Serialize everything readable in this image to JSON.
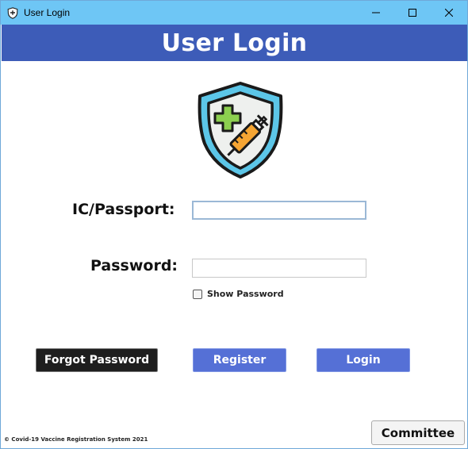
{
  "window": {
    "title": "User Login",
    "icon": "shield-vaccine-icon",
    "controls": [
      "minimize-icon",
      "maximize-icon",
      "close-icon"
    ]
  },
  "banner": {
    "heading": "User Login"
  },
  "logo": {
    "icon": "shield-syringe-icon"
  },
  "form": {
    "ic_label": "IC/Passport:",
    "ic_value": "",
    "password_label": "Password:",
    "password_value": "",
    "show_password_label": "Show Password",
    "show_password_checked": false
  },
  "buttons": {
    "forgot": "Forgot Password",
    "register": "Register",
    "login": "Login",
    "committee": "Committee"
  },
  "footer": {
    "text": "© Covid-19 Vaccine Registration System  2021"
  },
  "colors": {
    "titlebar": "#6ec6f5",
    "banner": "#3d5cb8",
    "primary_button": "#5570d6",
    "dark_button": "#1e1e1e"
  }
}
